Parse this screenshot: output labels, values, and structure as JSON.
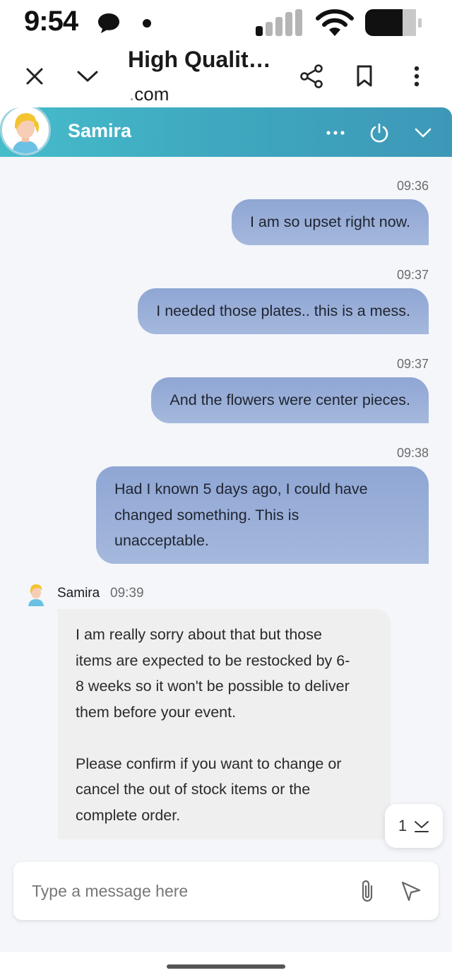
{
  "status_bar": {
    "time": "9:54",
    "icons": [
      "chat-bubble-icon",
      "dot-icon",
      "signal-icon",
      "wifi-icon",
      "battery-icon"
    ]
  },
  "browser": {
    "title": "High Qualit…",
    "url_prefix": ".",
    "url": "com",
    "icons": [
      "close-icon",
      "chevron-down-icon",
      "share-icon",
      "bookmark-icon",
      "more-vertical-icon"
    ]
  },
  "chat_header": {
    "agent_name": "Samira",
    "icons": [
      "more-horizontal-icon",
      "power-icon",
      "chevron-down-icon"
    ],
    "accent_color": "#3fa9c0"
  },
  "messages_out": [
    {
      "time": "09:36",
      "text": "I am so upset right now."
    },
    {
      "time": "09:37",
      "text": "I needed those plates.. this is a mess."
    },
    {
      "time": "09:37",
      "text": "And the flowers were center pieces."
    },
    {
      "time": "09:38",
      "text": "Had I known 5 days ago, I could have\nchanged something. This is\nunacceptable."
    }
  ],
  "agent_message": {
    "name": "Samira",
    "time": "09:39",
    "text": "I am really sorry about that but those\nitems are expected to be restocked by 6-\n8 weeks so it won't be possible to deliver\nthem before your event.\n\nPlease confirm if you want to change or\ncancel the out of stock items or the\ncomplete order."
  },
  "scroll_badge": {
    "count": "1"
  },
  "composer": {
    "placeholder": "Type a message here",
    "icons": [
      "paperclip-icon",
      "send-icon"
    ]
  }
}
